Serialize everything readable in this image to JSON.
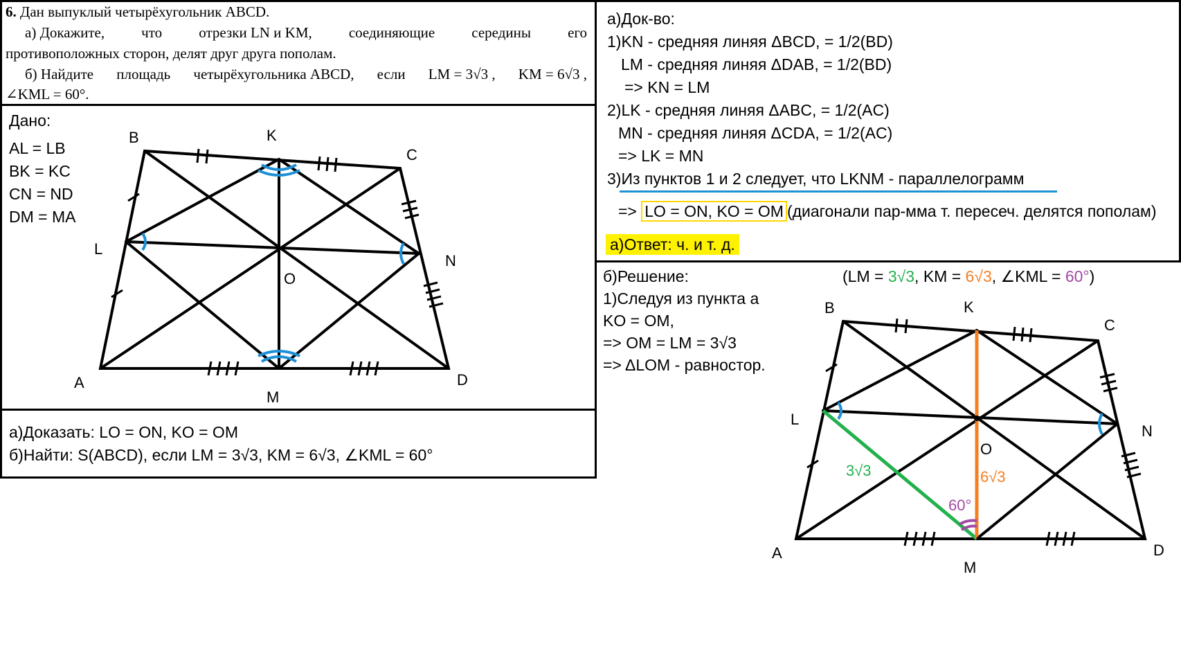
{
  "task": {
    "number": "6.",
    "intro": "Дан выпуклый четырёхугольник ABCD.",
    "a_words": [
      "а) Докажите,",
      "что",
      "отрезки LN и KM,",
      "соединяющие",
      "середины",
      "его"
    ],
    "a_line2": "противоположных сторон, делят друг друга пополам.",
    "b_words": [
      "б) Найдите",
      "площадь",
      "четырёхугольника ABCD,",
      "если",
      "LM = 3√3 ,",
      "KM = 6√3 ,"
    ],
    "b_line2": "∠KML = 60°."
  },
  "given": {
    "title": "Дано:",
    "lines": [
      "AL = LB",
      "BK = KC",
      "CN = ND",
      "DM = MA"
    ]
  },
  "prove": {
    "a": "а)Доказать: LO = ON, KO = OM",
    "b": "б)Найти: S(ABCD), если LM = 3√3, KM = 6√3, ∠KML = 60°"
  },
  "proof": {
    "title": "а)Док-во:",
    "lines": [
      "1)KN - средняя линяя ΔBCD, = 1/2(BD)",
      "LM - средняя линяя ΔDAB, = 1/2(BD)",
      "=> KN = LM",
      "2)LK - средняя линяя ΔABC, = 1/2(AC)",
      "MN - средняя линяя ΔCDA, = 1/2(AC)",
      "=> LK = MN"
    ],
    "step3": "3)Из пунктов 1 и 2 следует, что LKNM - параллелограмм",
    "concl_prefix": "=> ",
    "concl_box": "LO = ON, KO = OM",
    "concl_rest": "(диагонали пар-мма т. пересеч. делятся пополам)",
    "answer": "а)Ответ: ч. и т. д."
  },
  "solution": {
    "title": "б)Решение:",
    "given": {
      "open": "(LM = ",
      "lm": "3√3",
      "mid1": ", KM = ",
      "km": "6√3",
      "mid2": ", ∠KML = ",
      "angle": "60°",
      "close": ")"
    },
    "lines": [
      "1)Следуя из пункта а",
      "KO = OM,",
      "=> OM = LM = 3√3",
      "=> ΔLOM - равностор."
    ]
  },
  "diagram1": {
    "labels": {
      "A": "A",
      "B": "B",
      "C": "C",
      "D": "D",
      "K": "K",
      "L": "L",
      "M": "M",
      "N": "N",
      "O": "O"
    }
  },
  "diagram2": {
    "labels": {
      "A": "A",
      "B": "B",
      "C": "C",
      "D": "D",
      "K": "K",
      "L": "L",
      "M": "M",
      "N": "N",
      "O": "O"
    },
    "lm_value": "3√3",
    "km_value": "6√3",
    "angle_value": "60°"
  },
  "colors": {
    "green": "#22b14c",
    "orange": "#f57e20",
    "purple": "#a349a4",
    "blue": "#1e90d6",
    "highlight": "#fff200"
  }
}
